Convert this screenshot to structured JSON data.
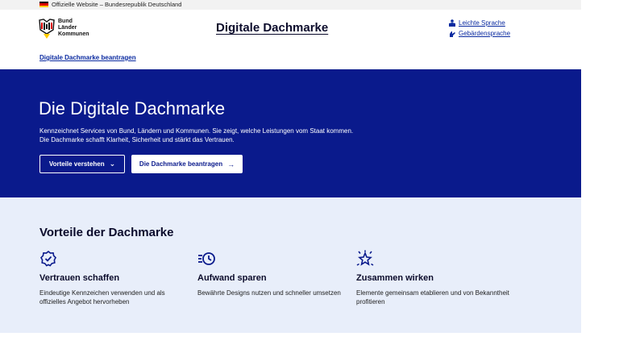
{
  "official_bar": {
    "text": "Offizielle Website – Bundesrepublik Deutschland"
  },
  "logo": {
    "line1": "Bund",
    "line2": "Länder",
    "line3": "Kommunen"
  },
  "header": {
    "title": "Digitale Dachmarke",
    "links": [
      {
        "label": "Leichte Sprache",
        "icon": "person-easy-language-icon"
      },
      {
        "label": "Gebärdensprache",
        "icon": "sign-language-icon"
      }
    ]
  },
  "nav": {
    "apply_link": "Digitale Dachmarke beantragen"
  },
  "hero": {
    "title": "Die Digitale Dachmarke",
    "description": "Kennzeichnet Services von Bund, Ländern und Kommunen. Sie zeigt, welche Leistungen vom Staat kommen. Die Dachmarke schafft Klarheit, Sicherheit und stärkt das Vertrauen.",
    "button_outline": "Vorteile verstehen",
    "button_solid": "Die Dachmarke beantragen"
  },
  "benefits": {
    "title": "Vorteile der Dachmarke",
    "items": [
      {
        "title": "Vertrauen schaffen",
        "text": "Eindeutige Kennzeichen verwenden und als offizielles Angebot hervorheben",
        "icon": "badge-check-icon"
      },
      {
        "title": "Aufwand sparen",
        "text": "Bewährte Designs nutzen und schneller umsetzen",
        "icon": "fast-clock-icon"
      },
      {
        "title": "Zusammen wirken",
        "text": "Elemente gemeinsam etablieren und von Bekanntheit profitieren",
        "icon": "star-sparkle-icon"
      }
    ]
  },
  "colors": {
    "primary": "#0a1a8c",
    "link": "#0a2aa0",
    "benefits_bg": "#e8eefa"
  }
}
